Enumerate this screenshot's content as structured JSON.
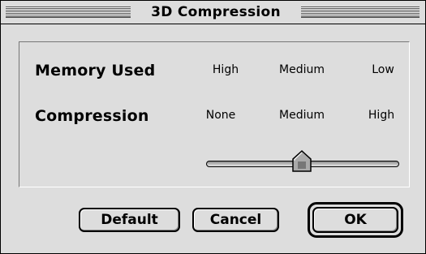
{
  "window": {
    "title": "3D Compression"
  },
  "rows": [
    {
      "label": "Memory Used",
      "values": [
        "High",
        "Medium",
        "Low"
      ]
    },
    {
      "label": "Compression",
      "values": [
        "None",
        "Medium",
        "High"
      ]
    }
  ],
  "slider": {
    "positions": 3,
    "selected_index": 1,
    "selected_value": "Medium"
  },
  "buttons": {
    "default_label": "Default",
    "cancel_label": "Cancel",
    "ok_label": "OK"
  }
}
